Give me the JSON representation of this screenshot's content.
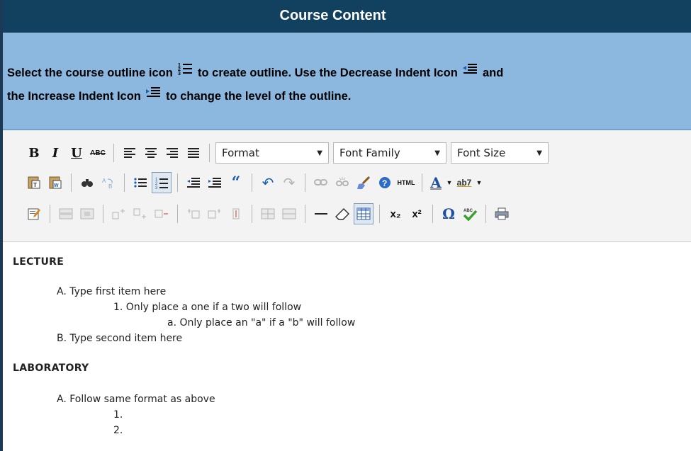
{
  "header": {
    "title": "Course Content"
  },
  "instructions": {
    "line1_part1": "Select the course outline icon",
    "line1_part2": "to create outline. Use the Decrease Indent Icon",
    "line1_part3": "and",
    "line2_part1": "the Increase Indent Icon",
    "line2_part2": "to change the level of the outline."
  },
  "toolbar": {
    "format_label": "Format",
    "font_family_label": "Font Family",
    "font_size_label": "Font Size",
    "bold_label": "B",
    "italic_label": "I",
    "underline_label": "U",
    "strike_label": "ABC",
    "html_label": "HTML",
    "superscript_label": "x²",
    "subscript_label": "x₂",
    "omega_label": "Ω",
    "quote_label": "“",
    "font_color_label": "A",
    "highlight_label": "ab7"
  },
  "editor": {
    "lecture_heading": "LECTURE",
    "lecture_items": [
      "A. Type first item here",
      "1. Only place a one if a two will follow",
      "a. Only place an \"a\" if a \"b\" will follow",
      "B. Type second item here"
    ],
    "lab_heading": "LABORATORY",
    "lab_items": [
      "A. Follow same format as above",
      "1.",
      "2."
    ]
  },
  "colors": {
    "header_bg": "#12415f",
    "instructions_bg": "#8cb8e0",
    "toolbar_bg": "#f3f3f3"
  }
}
